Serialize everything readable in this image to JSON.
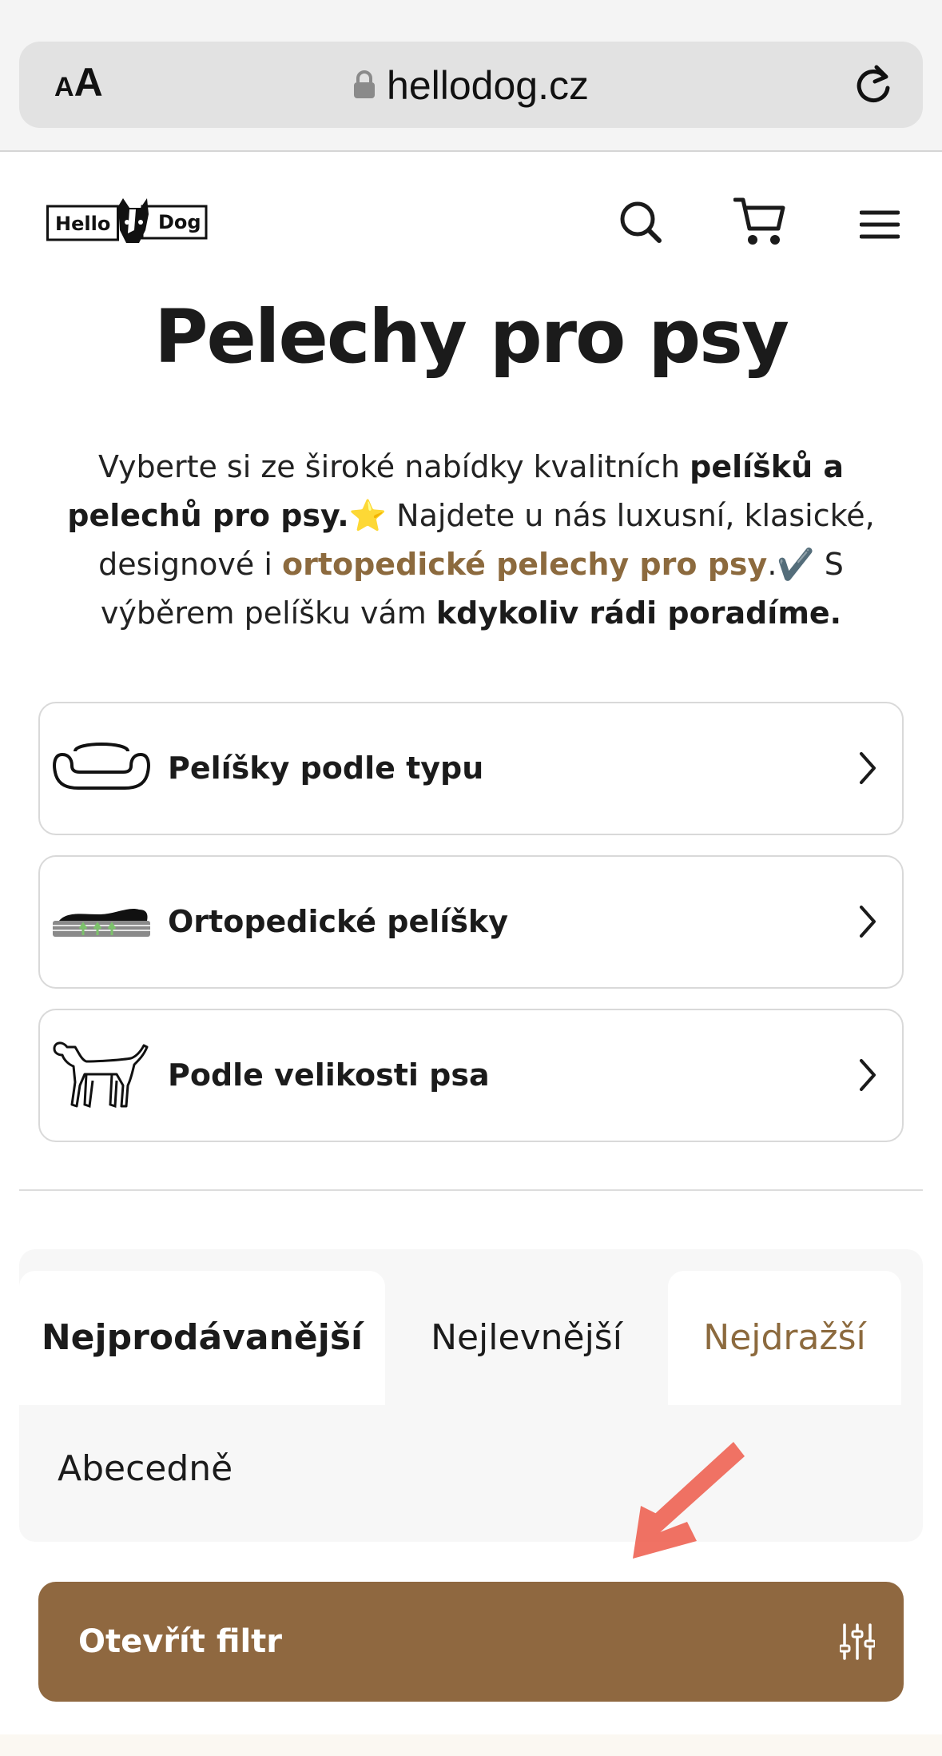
{
  "browser": {
    "text_size_label_small": "A",
    "text_size_label_big": "A",
    "url": "hellodog.cz"
  },
  "header": {
    "logo_left": "Hello",
    "logo_right": "Dog"
  },
  "page": {
    "title": "Pelechy pro psy",
    "intro": {
      "p1": "Vyberte si ze široké nabídky kvalitních ",
      "b1": "pelíšků a pelechů pro psy.",
      "p2": "⭐ Najdete u nás luxusní, klasické, designové i ",
      "link": "ortopedické pelechy pro psy",
      "p3": ".✔️ S výběrem pelíšku vám ",
      "b2": "kdykoliv rádi poradíme."
    }
  },
  "categories": [
    {
      "label": "Pelíšky podle typu",
      "icon": "dog-bed-icon"
    },
    {
      "label": "Ortopedické pelíšky",
      "icon": "orthopedic-bed-icon"
    },
    {
      "label": "Podle velikosti psa",
      "icon": "dog-icon"
    }
  ],
  "sort": {
    "tabs": [
      "Nejprodávanější",
      "Nejlevnější",
      "Nejdražší",
      "Abecedně"
    ],
    "active": "Nejprodávanější"
  },
  "filter": {
    "label": "Otevřít filtr"
  },
  "colors": {
    "brand_brown": "#8f6840",
    "link_brown": "#8c6a3e",
    "arrow_red": "#ee5a4a"
  }
}
